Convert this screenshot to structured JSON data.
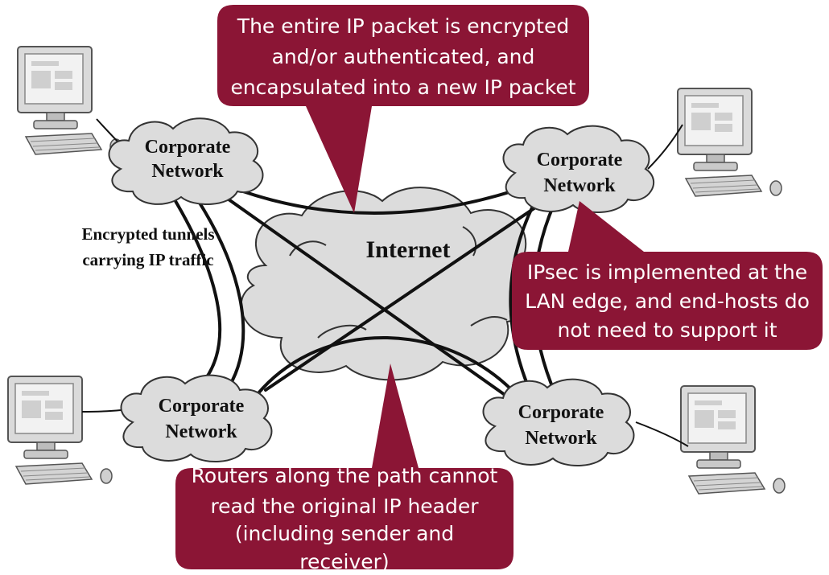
{
  "diagram": {
    "internet_label": "Internet",
    "tunnels_label_line1": "Encrypted tunnels",
    "tunnels_label_line2": "carrying IP traffic",
    "networks": [
      {
        "line1": "Corporate",
        "line2": "Network"
      },
      {
        "line1": "Corporate",
        "line2": "Network"
      },
      {
        "line1": "Corporate",
        "line2": "Network"
      },
      {
        "line1": "Corporate",
        "line2": "Network"
      }
    ],
    "callouts": {
      "top": [
        "The entire IP packet is encrypted",
        "and/or authenticated, and",
        "encapsulated into a new IP packet"
      ],
      "right": [
        "IPsec is implemented at the",
        "LAN edge, and end-hosts do",
        "not need to support it"
      ],
      "bottom": [
        "Routers along the path cannot",
        "read the original IP header",
        "(including sender and",
        "receiver)"
      ]
    },
    "colors": {
      "callout": "#8B1535",
      "cloud_fill": "#dcdcdc",
      "monitor_fill": "#e6e6e6"
    }
  }
}
